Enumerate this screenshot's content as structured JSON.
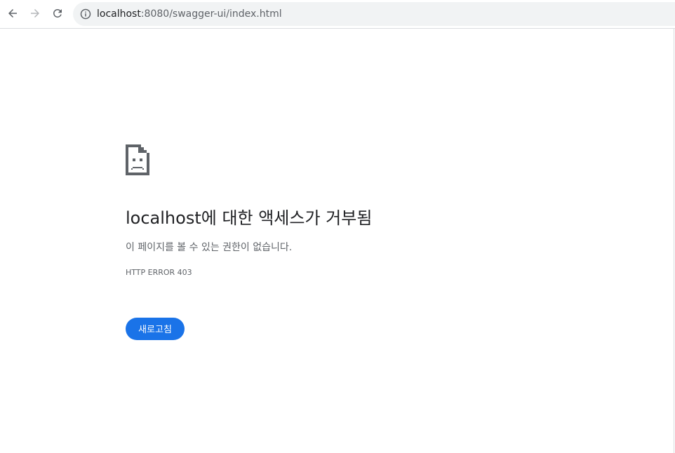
{
  "browser": {
    "url_host": "localhost",
    "url_rest": ":8080/swagger-ui/index.html",
    "icons": {
      "back": "back-arrow-icon",
      "forward": "forward-arrow-icon",
      "reload": "reload-icon",
      "site_info": "info-icon"
    }
  },
  "error_page": {
    "icon": "sad-document-icon",
    "title": "localhost에 대한 액세스가 거부됨",
    "message": "이 페이지를 볼 수 있는 권한이 없습니다.",
    "error_code": "HTTP ERROR 403",
    "reload_button_label": "새로고침"
  },
  "colors": {
    "accent": "#1a73e8",
    "title_text": "#202124",
    "secondary_text": "#5f6368",
    "omnibox_bg": "#f1f3f4"
  }
}
